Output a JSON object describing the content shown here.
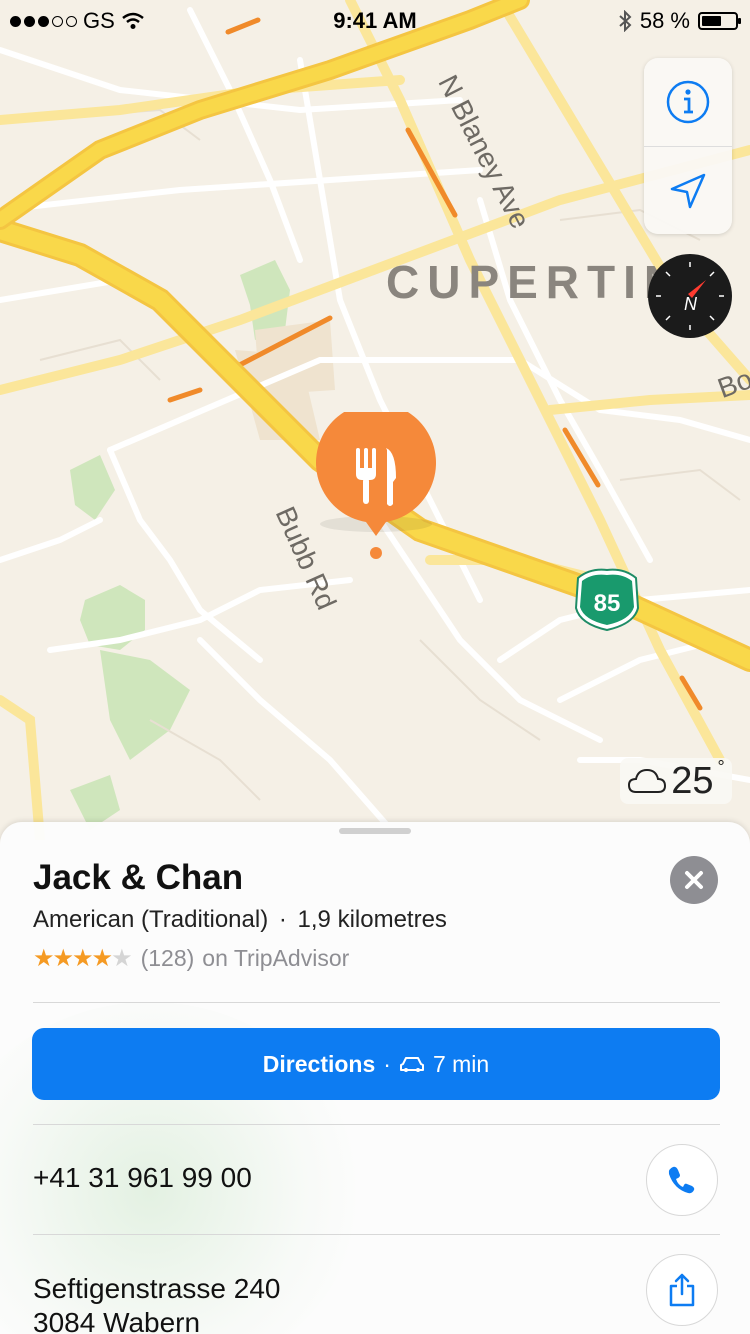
{
  "status_bar": {
    "carrier": "GS",
    "time": "9:41 AM",
    "battery": "58 %",
    "battery_level": 0.58
  },
  "map": {
    "city_label": "CUPERTIN",
    "street_labels": [
      "N Blaney Ave",
      "Bubb Rd",
      "Bo"
    ],
    "highway_shield": "85",
    "weather_temp": "25",
    "weather_unit": "°",
    "pin_icon": "fork-knife-icon"
  },
  "place": {
    "name": "Jack & Chan",
    "category": "American (Traditional)",
    "separator": "·",
    "distance": "1,9 kilometres",
    "rating": 4,
    "rating_max": 5,
    "review_count": "(128)",
    "review_source": "on TripAdvisor",
    "directions_label": "Directions",
    "directions_sep": "·",
    "directions_time": "7 min",
    "phone": "+41 31 961 99 00",
    "address_line1": "Seftigenstrasse 240",
    "address_line2": "3084 Wabern"
  },
  "colors": {
    "accent": "#0d7cf2",
    "pin": "#f5893a",
    "highway": "#f9d34a",
    "star": "#f59a23"
  }
}
